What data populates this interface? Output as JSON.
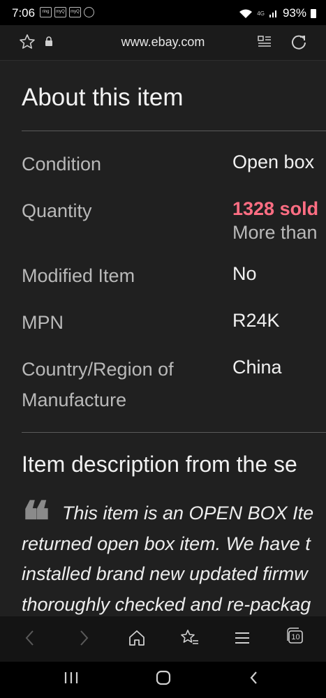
{
  "status_bar": {
    "time": "7:06",
    "notifications": [
      "ring",
      "myQ",
      "myQ",
      "app"
    ],
    "network": "4G",
    "battery": "93%"
  },
  "browser": {
    "url": "www.ebay.com",
    "icons": [
      "star-icon",
      "lock-icon",
      "reader-mode-icon",
      "reload-icon"
    ]
  },
  "page": {
    "heading": "About this item",
    "specs": [
      {
        "label": "Condition",
        "value": "Open box"
      },
      {
        "label": "Quantity",
        "value": "1328 sold",
        "note": "More than"
      },
      {
        "label": "Modified Item",
        "value": "No"
      },
      {
        "label": "MPN",
        "value": "R24K"
      },
      {
        "label": "Country/Region of Manufacture",
        "value": "China"
      }
    ],
    "description_heading": "Item description from the se",
    "description_lines": [
      "This item is an OPEN BOX Ite",
      "returned open box item. We have t",
      "installed brand new updated firmw",
      "thoroughly checked and re-packag"
    ]
  },
  "toolbar": {
    "tab_count": "10",
    "icons": [
      "back-icon",
      "forward-icon",
      "home-icon",
      "bookmarks-icon",
      "menu-icon",
      "tabs-icon"
    ]
  },
  "colors": {
    "background": "#202020",
    "accent_sold": "#ff6e83"
  }
}
